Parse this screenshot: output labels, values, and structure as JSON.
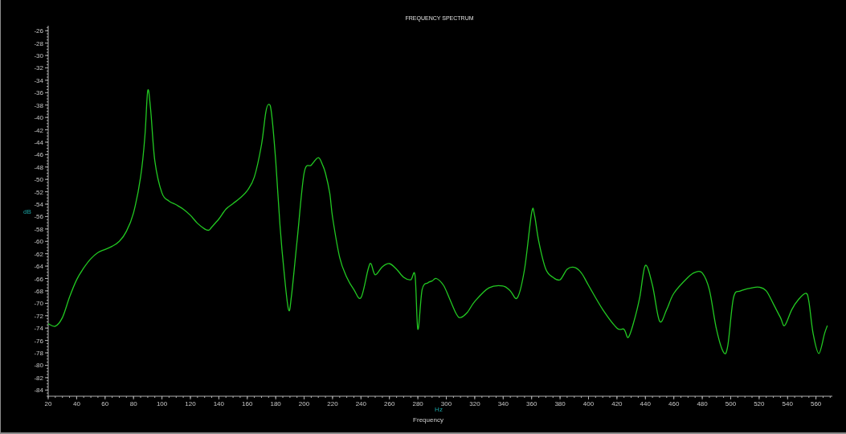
{
  "chart_data": {
    "type": "line",
    "title": "FREQUENCY SPECTRUM",
    "xlabel": "Frequency",
    "ylabel": "dB",
    "xlim": [
      20,
      571.5
    ],
    "ylim": [
      -85,
      -25.2
    ],
    "xticks": [
      20,
      40,
      60,
      80,
      100,
      120,
      140,
      160,
      180,
      200,
      220,
      240,
      260,
      280,
      300,
      320,
      340,
      360,
      380,
      400,
      420,
      440,
      460,
      480,
      500,
      520,
      540,
      560
    ],
    "yticks": [
      -26,
      -28,
      -30,
      -32,
      -34,
      -36,
      -38,
      -40,
      -42,
      -44,
      -46,
      -48,
      -50,
      -52,
      -54,
      -56,
      -58,
      -60,
      -62,
      -64,
      -66,
      -68,
      -70,
      -72,
      -74,
      -76,
      -78,
      -80,
      -82,
      -84
    ],
    "x": [
      20,
      25,
      30,
      35,
      40,
      45,
      50,
      55,
      60,
      65,
      70,
      75,
      80,
      85,
      88,
      90,
      92,
      95,
      100,
      105,
      110,
      115,
      120,
      125,
      130,
      133,
      135,
      140,
      145,
      150,
      155,
      160,
      165,
      170,
      173,
      175,
      177,
      180,
      183,
      186,
      189,
      191,
      195,
      200,
      205,
      210,
      213,
      215,
      218,
      220,
      225,
      230,
      235,
      240,
      245,
      247,
      250,
      255,
      260,
      265,
      270,
      275,
      278,
      280,
      283,
      287,
      290,
      293,
      298,
      302,
      307,
      310,
      315,
      320,
      330,
      340,
      345,
      350,
      355,
      360,
      362,
      365,
      370,
      375,
      380,
      385,
      390,
      395,
      400,
      410,
      420,
      425,
      428,
      432,
      436,
      440,
      445,
      450,
      455,
      460,
      470,
      475,
      480,
      485,
      490,
      495,
      498,
      502,
      507,
      515,
      520,
      525,
      530,
      535,
      538,
      543,
      548,
      553,
      555,
      558,
      562,
      566,
      568
    ],
    "series": [
      {
        "color": "#22c822",
        "values": [
          -73.3,
          -73.7,
          -72.3,
          -69,
          -66.2,
          -64.3,
          -62.8,
          -61.8,
          -61.3,
          -60.8,
          -60,
          -58.4,
          -55.4,
          -49.6,
          -43.1,
          -35.7,
          -38.6,
          -47,
          -52.2,
          -53.5,
          -54.1,
          -54.8,
          -55.8,
          -57.1,
          -58,
          -58.2,
          -57.7,
          -56.4,
          -54.8,
          -53.9,
          -53,
          -51.8,
          -49.6,
          -44.4,
          -39.2,
          -37.9,
          -39.2,
          -47,
          -57.4,
          -65.2,
          -71,
          -69,
          -60,
          -49,
          -47.7,
          -46.5,
          -47.7,
          -49,
          -52.2,
          -56.1,
          -62.6,
          -65.8,
          -67.8,
          -69.1,
          -64.5,
          -63.6,
          -65.4,
          -64.1,
          -63.6,
          -64.5,
          -65.8,
          -66.2,
          -65.5,
          -74.2,
          -67.8,
          -66.7,
          -66.4,
          -66,
          -67.1,
          -69.1,
          -71.7,
          -72.3,
          -71.4,
          -69.7,
          -67.5,
          -67.2,
          -68,
          -69.1,
          -64.5,
          -55.4,
          -55.7,
          -60,
          -64.5,
          -65.8,
          -66.2,
          -64.5,
          -64.2,
          -65.1,
          -67.1,
          -71,
          -74,
          -74.2,
          -75.5,
          -72.9,
          -69.1,
          -63.9,
          -67.1,
          -72.9,
          -71,
          -68.4,
          -65.8,
          -65,
          -65.1,
          -67.8,
          -74.2,
          -77.9,
          -76.8,
          -69.1,
          -68,
          -67.5,
          -67.4,
          -68,
          -70.1,
          -72.3,
          -73.6,
          -71,
          -69.3,
          -68.4,
          -69.7,
          -74.9,
          -78.1,
          -74.9,
          -73.6
        ]
      }
    ]
  },
  "x_unit": "Hz"
}
